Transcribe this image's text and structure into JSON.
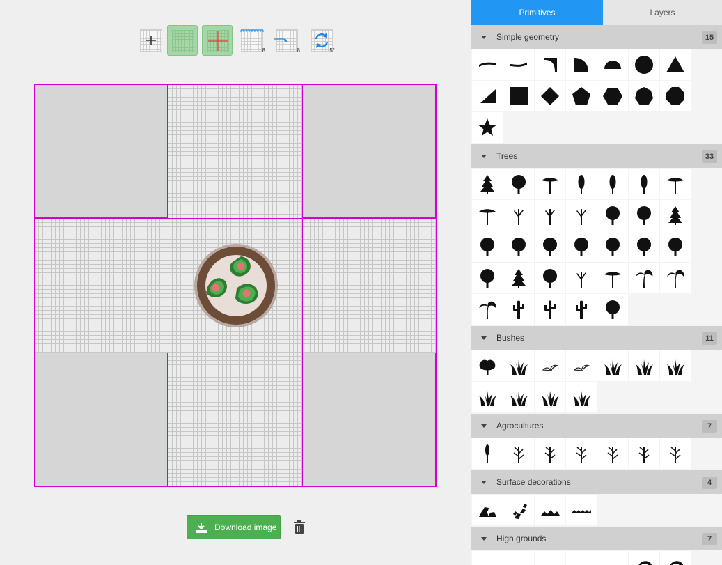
{
  "tabs": [
    {
      "label": "Primitives",
      "active": true
    },
    {
      "label": "Layers",
      "active": false
    }
  ],
  "toolbar": {
    "tools": [
      {
        "icon": "add-icon",
        "active": false,
        "value": ""
      },
      {
        "icon": "grid-icon",
        "active": true,
        "value": ""
      },
      {
        "icon": "crosshair-icon",
        "active": true,
        "value": ""
      },
      {
        "icon": "ruler-icon",
        "active": false,
        "value": "8"
      },
      {
        "icon": "snap-icon",
        "active": false,
        "value": "8"
      },
      {
        "icon": "rotate-icon",
        "active": false,
        "value": "5°"
      }
    ]
  },
  "actions": {
    "download_label": "Download image",
    "download_icon": "download-icon",
    "delete_icon": "trash-icon"
  },
  "colors": {
    "accent": "#2196f3",
    "primary_button": "#4caf50",
    "guide": "#d000d0",
    "canvas_block": "#d6d6d6"
  },
  "sections": [
    {
      "title": "Simple geometry",
      "count": "15",
      "items": [
        "curve-a",
        "curve-b",
        "corner-curve",
        "quarter-circle",
        "half-circle",
        "circle",
        "triangle",
        "right-triangle",
        "square",
        "diamond",
        "pentagon",
        "hexagon",
        "heptagon",
        "octagon",
        "star"
      ]
    },
    {
      "title": "Trees",
      "count": "33",
      "items": [
        "tree-1",
        "tree-2",
        "tree-3",
        "tree-4",
        "tree-5",
        "tree-6",
        "tree-7",
        "tree-8",
        "tree-9",
        "tree-10",
        "tree-11",
        "tree-12",
        "tree-13",
        "tree-14",
        "tree-15",
        "tree-16",
        "tree-17",
        "tree-18",
        "tree-19",
        "tree-20",
        "tree-21",
        "tree-22",
        "tree-23",
        "tree-24",
        "tree-25",
        "tree-26",
        "tree-27",
        "tree-28",
        "tree-29",
        "tree-30",
        "tree-31",
        "tree-32",
        "tree-33"
      ]
    },
    {
      "title": "Bushes",
      "count": "11",
      "items": [
        "bush-1",
        "bush-2",
        "bush-3",
        "bush-4",
        "bush-5",
        "bush-6",
        "bush-7",
        "bush-8",
        "bush-9",
        "bush-10",
        "bush-11"
      ]
    },
    {
      "title": "Agrocultures",
      "count": "7",
      "items": [
        "crop-1",
        "crop-2",
        "crop-3",
        "crop-4",
        "crop-5",
        "crop-6",
        "crop-7"
      ]
    },
    {
      "title": "Surface decorations",
      "count": "4",
      "items": [
        "rocks",
        "rubble",
        "ridge",
        "waves"
      ]
    },
    {
      "title": "High grounds",
      "count": "7",
      "items": [
        "hill-1",
        "hill-2",
        "hill-3",
        "hill-4",
        "hill-5",
        "hill-6",
        "hill-7"
      ]
    }
  ]
}
